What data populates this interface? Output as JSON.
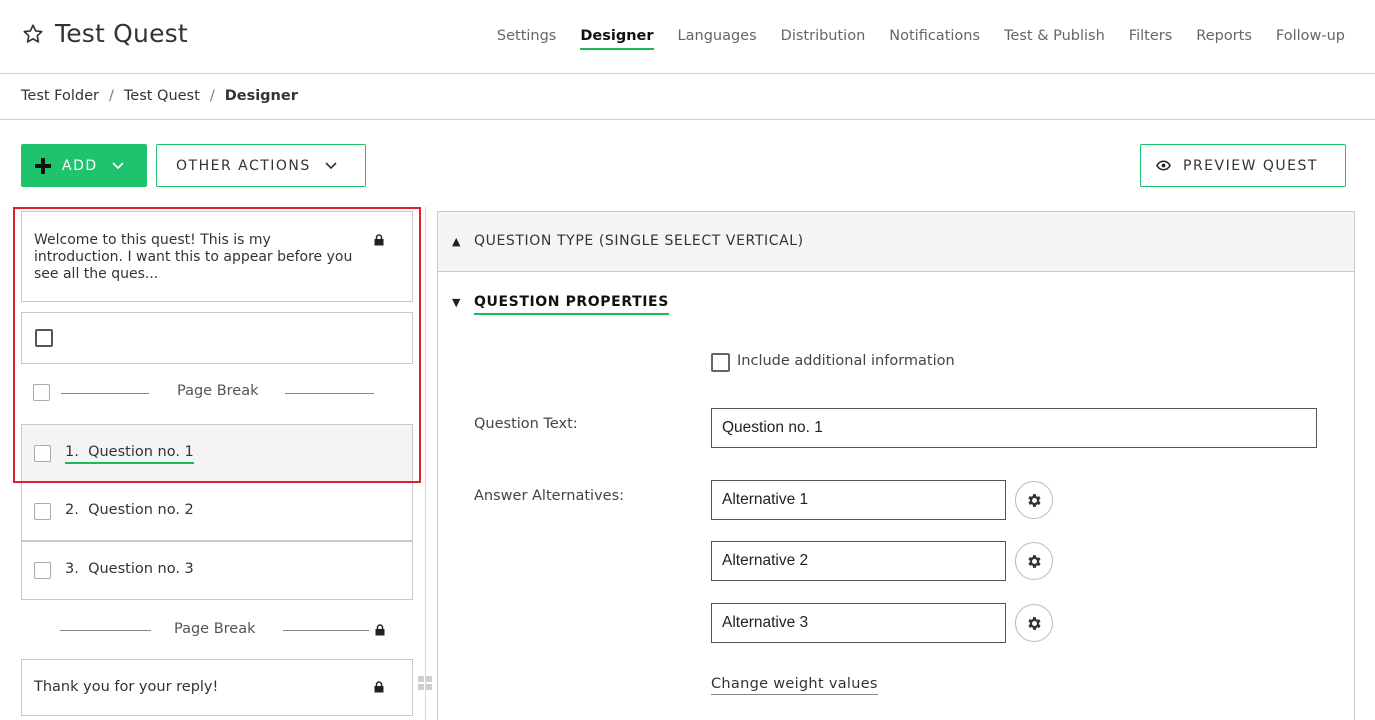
{
  "header": {
    "title": "Test Quest",
    "nav": [
      {
        "label": "Settings",
        "active": false
      },
      {
        "label": "Designer",
        "active": true
      },
      {
        "label": "Languages",
        "active": false
      },
      {
        "label": "Distribution",
        "active": false
      },
      {
        "label": "Notifications",
        "active": false
      },
      {
        "label": "Test & Publish",
        "active": false
      },
      {
        "label": "Filters",
        "active": false
      },
      {
        "label": "Reports",
        "active": false
      },
      {
        "label": "Follow-up",
        "active": false
      }
    ]
  },
  "breadcrumb": {
    "items": [
      "Test Folder",
      "Test Quest"
    ],
    "current": "Designer"
  },
  "toolbar": {
    "add_label": "ADD",
    "other_actions_label": "OTHER ACTIONS",
    "preview_label": "PREVIEW QUEST"
  },
  "list": {
    "intro_text": "Welcome to this quest! This is my introduction. I want this to appear before you see all the ques...",
    "page_break_label": "Page Break",
    "questions": [
      {
        "number": "1.",
        "label": "Question no. 1",
        "selected": true
      },
      {
        "number": "2.",
        "label": "Question no. 2",
        "selected": false
      },
      {
        "number": "3.",
        "label": "Question no. 3",
        "selected": false
      }
    ],
    "thanks_text": "Thank you for your reply!"
  },
  "panel": {
    "question_type_label": "QUESTION TYPE (SINGLE SELECT VERTICAL)",
    "question_properties_label": "QUESTION PROPERTIES",
    "include_info_label": "Include additional information",
    "question_text_label": "Question Text:",
    "question_text_value": "Question no. 1",
    "answer_alternatives_label": "Answer Alternatives:",
    "alternatives": [
      "Alternative 1",
      "Alternative 2",
      "Alternative 3"
    ],
    "change_weight_label": "Change weight values"
  },
  "colors": {
    "accent_green": "#1fc36e",
    "highlight_red": "#d9232d"
  }
}
